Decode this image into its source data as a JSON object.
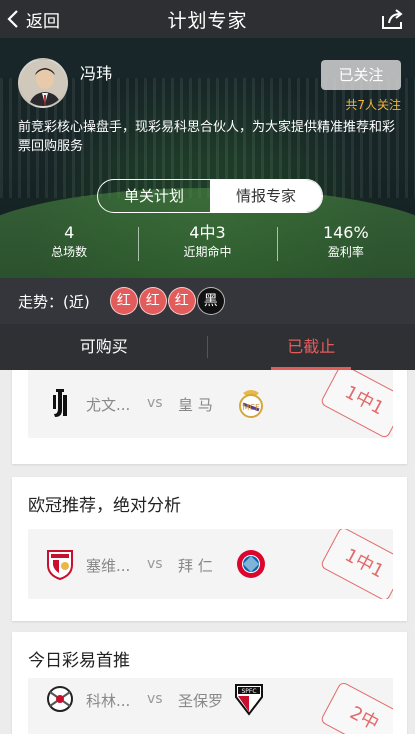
{
  "nav": {
    "back_label": "返回",
    "title": "计划专家",
    "share_icon": "share-icon",
    "back_icon": "chevron-left-icon"
  },
  "expert": {
    "name": "冯玮",
    "follow_label": "已关注",
    "follower_text": "共7人关注",
    "bio": "前竞彩核心操盘手，现彩易科思合伙人，为大家提供精准推荐和彩票回购服务"
  },
  "plan_tabs": [
    {
      "label": "单关计划",
      "active": false
    },
    {
      "label": "情报专家",
      "active": true
    }
  ],
  "stats": [
    {
      "value": "4",
      "label": "总场数"
    },
    {
      "value": "4中3",
      "label": "近期命中"
    },
    {
      "value": "146%",
      "label": "盈利率"
    }
  ],
  "trend": {
    "label": "走势：(近)",
    "badges": [
      {
        "text": "红",
        "color": "#e25c5c"
      },
      {
        "text": "红",
        "color": "#e25c5c"
      },
      {
        "text": "红",
        "color": "#e25c5c"
      },
      {
        "text": "黑",
        "color": "#111111"
      }
    ]
  },
  "buy_tabs": [
    {
      "label": "可购买",
      "active": false
    },
    {
      "label": "已截止",
      "active": true
    }
  ],
  "cards": [
    {
      "title": "",
      "home": "尤文...",
      "vs": "vs",
      "away": "皇 马",
      "home_logo": "juventus-logo-icon",
      "away_logo": "real-madrid-logo-icon",
      "stamp": "1中1"
    },
    {
      "title": "欧冠推荐，绝对分析",
      "home": "塞维...",
      "vs": "vs",
      "away": "拜 仁",
      "home_logo": "sevilla-logo-icon",
      "away_logo": "bayern-logo-icon",
      "stamp": "1中1"
    },
    {
      "title": "今日彩易首推",
      "home": "科林...",
      "vs": "vs",
      "away": "圣保罗",
      "home_logo": "corinthians-logo-icon",
      "away_logo": "sao-paulo-logo-icon",
      "stamp": "2中"
    }
  ],
  "colors": {
    "accent": "#e25c5c",
    "gold": "#f0b43a",
    "nav_bg": "#2e2f33"
  }
}
